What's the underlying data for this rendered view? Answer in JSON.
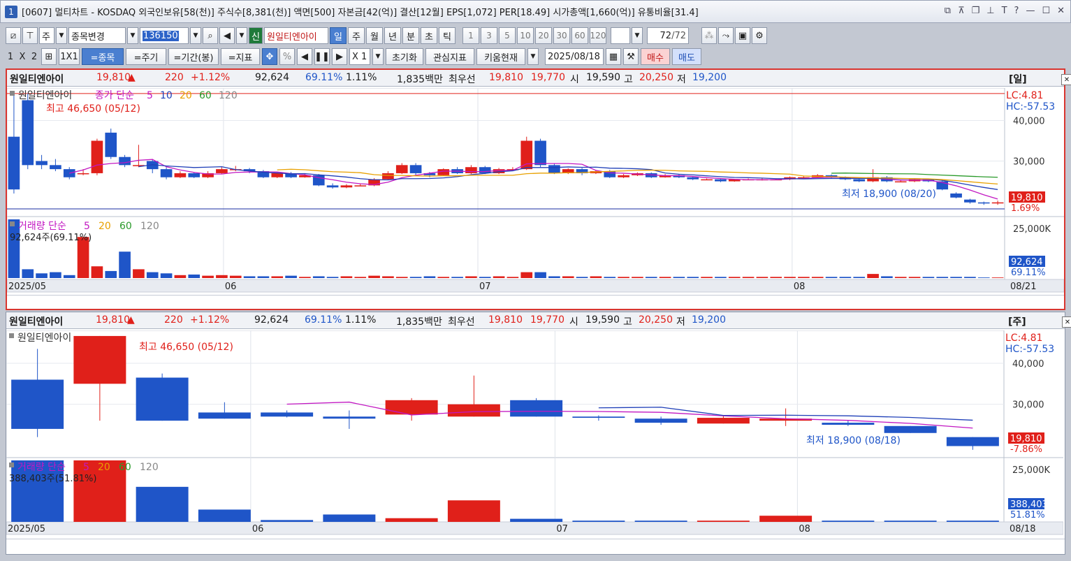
{
  "window": {
    "index": "1",
    "title": "[0607] 멀티차트 - KOSDAQ 외국인보유[58(천)] 주식수[8,381(천)] 액면[500] 자본금[42(억)] 결산[12월] EPS[1,072] PER[18.49] 시가총액[1,660(억)] 유통비율[31.4]"
  },
  "toolbar": {
    "market": "주",
    "change_label": "종목변경",
    "code": "136150",
    "sin": "신",
    "stock_name": "원일티엔아이",
    "periods": [
      "일",
      "주",
      "월",
      "년",
      "분",
      "초",
      "틱"
    ],
    "nums": [
      "1",
      "3",
      "5",
      "10",
      "20",
      "30",
      "60",
      "120"
    ],
    "count": "72",
    "count_total": "/72",
    "layout": [
      "1",
      "X",
      "2"
    ],
    "one_by_one": "1X1",
    "tabs": [
      "=종목",
      "=주기",
      "=기간(봉)",
      "=지표"
    ],
    "pct": "%",
    "mult": "X 1",
    "reset": "초기화",
    "interest": "관심지표",
    "kiwoom": "키움현재",
    "date": "2025/08/18",
    "buy": "매수",
    "sell": "매도"
  },
  "panel1": {
    "name": "원일티엔아이",
    "price": "19,810",
    "arrow": "▲",
    "change": "220",
    "pct": "+1.12%",
    "volume": "92,624",
    "vratio": "69.11%",
    "turn": "1.11%",
    "amount": "1,835백만",
    "best_label": "최우선",
    "ask": "19,810",
    "bid": "19,770",
    "open_l": "시",
    "open": "19,590",
    "high_l": "고",
    "high": "20,250",
    "low_l": "저",
    "low": "19,200",
    "period": "[일]",
    "legend_name": "원일티엔아이",
    "legend_ma": "종가 단순",
    "ma": [
      "5",
      "10",
      "20",
      "60",
      "120"
    ],
    "max_label": "최고 46,650 (05/12)",
    "min_label": "최저 18,900 (08/20)",
    "lc": "LC:4.81",
    "hc": "HC:-57.53",
    "cur_price": "19,810",
    "cur_pct": "1.69%",
    "vol_legend": "거래량 단순",
    "vol_ma": [
      "5",
      "20",
      "60",
      "120"
    ],
    "vol_val": "92,624주(69.11%)",
    "vol_axis": "25,000K",
    "vol_cur": "92,624",
    "vol_pct": "69.11%",
    "dates": [
      "2025/05",
      "06",
      "07",
      "08"
    ],
    "last_date": "08/21"
  },
  "panel2": {
    "name": "원일티엔아이",
    "price": "19,810",
    "arrow": "▲",
    "change": "220",
    "pct": "+1.12%",
    "volume": "92,624",
    "vratio": "69.11%",
    "turn": "1.11%",
    "amount": "1,835백만",
    "best_label": "최우선",
    "ask": "19,810",
    "bid": "19,770",
    "open_l": "시",
    "open": "19,590",
    "high_l": "고",
    "high": "20,250",
    "low_l": "저",
    "low": "19,200",
    "period": "[주]",
    "legend_name": "원일티엔아이",
    "max_label": "최고 46,650 (05/12)",
    "min_label": "최저 18,900 (08/18)",
    "lc": "LC:4.81",
    "hc": "HC:-57.53",
    "cur_price": "19,810",
    "cur_pct": "-7.86%",
    "vol_legend": "거래량 단순",
    "vol_ma": [
      "5",
      "20",
      "60",
      "120"
    ],
    "vol_val": "388,403주(51.81%)",
    "vol_axis": "25,000K",
    "vol_cur": "388,403",
    "vol_pct": "51.81%",
    "dates": [
      "2025/05",
      "06",
      "07",
      "08"
    ],
    "last_date": "08/18"
  },
  "axis": {
    "ticks": [
      "40,000",
      "30,000"
    ]
  },
  "chart_data": [
    {
      "type": "candlestick",
      "title": "원일티엔아이 일봉",
      "ylim": [
        17000,
        48000
      ],
      "candles": [
        [
          36000,
          23000,
          46650,
          22000
        ],
        [
          45000,
          29000,
          46650,
          28000
        ],
        [
          30000,
          29000,
          31500,
          28000
        ],
        [
          29000,
          28000,
          30500,
          27500
        ],
        [
          28000,
          26000,
          28500,
          25500
        ],
        [
          27000,
          27000,
          28000,
          26500
        ],
        [
          27000,
          35000,
          35500,
          26500
        ],
        [
          37000,
          31000,
          38000,
          30500
        ],
        [
          31000,
          29000,
          31500,
          28500
        ],
        [
          29000,
          29000,
          34000,
          28500
        ],
        [
          30000,
          28000,
          30500,
          27000
        ],
        [
          28000,
          26000,
          28500,
          25500
        ],
        [
          26000,
          27000,
          27500,
          25800
        ],
        [
          27000,
          26000,
          27200,
          25800
        ],
        [
          26000,
          27000,
          27500,
          25800
        ],
        [
          27000,
          28000,
          28500,
          26800
        ],
        [
          28000,
          28000,
          28800,
          27500
        ],
        [
          28000,
          27500,
          28300,
          27000
        ],
        [
          27500,
          26000,
          27800,
          25800
        ],
        [
          26000,
          27000,
          27200,
          25800
        ],
        [
          27000,
          26000,
          27300,
          25800
        ],
        [
          26000,
          26500,
          26800,
          25900
        ],
        [
          26500,
          24000,
          26800,
          23800
        ],
        [
          24000,
          23500,
          24500,
          23200
        ],
        [
          23500,
          24000,
          24300,
          23300
        ],
        [
          24000,
          24000,
          24500,
          23800
        ],
        [
          24000,
          25500,
          25800,
          23800
        ],
        [
          25500,
          27000,
          27500,
          25300
        ],
        [
          27000,
          29000,
          29500,
          26800
        ],
        [
          29000,
          27000,
          29500,
          26500
        ],
        [
          27000,
          26500,
          27300,
          26000
        ],
        [
          26500,
          28000,
          28200,
          26300
        ],
        [
          28000,
          27000,
          28500,
          26800
        ],
        [
          27000,
          28500,
          29000,
          26800
        ],
        [
          28500,
          27000,
          28800,
          26800
        ],
        [
          27000,
          28000,
          28300,
          26800
        ],
        [
          28000,
          28000,
          28500,
          27500
        ],
        [
          28000,
          35000,
          36000,
          27800
        ],
        [
          35000,
          29000,
          35500,
          28500
        ],
        [
          29000,
          27000,
          29300,
          26800
        ],
        [
          27000,
          28000,
          28200,
          26800
        ],
        [
          28000,
          27000,
          28300,
          26500
        ],
        [
          27000,
          27500,
          27800,
          26800
        ],
        [
          27500,
          26000,
          27800,
          25800
        ],
        [
          26000,
          26500,
          26800,
          25800
        ],
        [
          26500,
          27000,
          27200,
          26300
        ],
        [
          27000,
          26000,
          27200,
          25800
        ],
        [
          26000,
          26500,
          26800,
          25900
        ],
        [
          26500,
          26000,
          26700,
          25800
        ],
        [
          26000,
          25500,
          26200,
          25300
        ],
        [
          25500,
          25500,
          25700,
          25300
        ],
        [
          25500,
          25000,
          25700,
          24800
        ],
        [
          25000,
          25500,
          25600,
          24900
        ],
        [
          25500,
          25500,
          25700,
          25300
        ],
        [
          25500,
          25500,
          25700,
          25200
        ],
        [
          25500,
          25500,
          25700,
          25300
        ],
        [
          25500,
          26000,
          26200,
          25300
        ],
        [
          26000,
          26000,
          26200,
          25800
        ],
        [
          26000,
          26500,
          26800,
          25800
        ],
        [
          26500,
          26000,
          26700,
          25800
        ],
        [
          26000,
          25500,
          26200,
          25300
        ],
        [
          25500,
          25000,
          25700,
          24800
        ],
        [
          25000,
          26000,
          28000,
          24800
        ],
        [
          26000,
          25000,
          26300,
          24800
        ],
        [
          25000,
          25000,
          25300,
          24800
        ],
        [
          25000,
          25500,
          25700,
          24800
        ],
        [
          25500,
          25000,
          25700,
          24800
        ],
        [
          25000,
          23000,
          25200,
          22800
        ],
        [
          22000,
          21000,
          22300,
          20800
        ],
        [
          20500,
          19800,
          20700,
          19500
        ],
        [
          19800,
          19600,
          20000,
          19200
        ],
        [
          19590,
          19810,
          20250,
          19200
        ]
      ],
      "volume": [
        100,
        15,
        8,
        10,
        5,
        70,
        20,
        12,
        45,
        15,
        10,
        8,
        5,
        6,
        4,
        5,
        4,
        3,
        3,
        3,
        4,
        2,
        3,
        2,
        3,
        2,
        4,
        3,
        2,
        2,
        3,
        2,
        2,
        3,
        2,
        3,
        2,
        10,
        10,
        3,
        3,
        2,
        3,
        2,
        2,
        2,
        2,
        2,
        2,
        2,
        2,
        2,
        2,
        2,
        2,
        2,
        2,
        2,
        2,
        2,
        2,
        2,
        7,
        3,
        2,
        2,
        2,
        2,
        2,
        2,
        1,
        1
      ]
    },
    {
      "type": "candlestick",
      "title": "원일티엔아이 주봉",
      "ylim": [
        17000,
        48000
      ],
      "candles": [
        [
          36000,
          24000,
          43500,
          22000
        ],
        [
          35000,
          46650,
          46650,
          26000
        ],
        [
          36500,
          26000,
          37500,
          26000
        ],
        [
          28000,
          26500,
          30500,
          26500
        ],
        [
          28000,
          27000,
          28500,
          26800
        ],
        [
          27000,
          26500,
          28500,
          24000
        ],
        [
          27500,
          31000,
          31500,
          26000
        ],
        [
          27000,
          30000,
          37000,
          27000
        ],
        [
          31000,
          27000,
          31500,
          27000
        ],
        [
          27000,
          26700,
          27300,
          26000
        ],
        [
          26500,
          25500,
          27000,
          25000
        ],
        [
          25300,
          26700,
          27200,
          25300
        ],
        [
          26000,
          26500,
          29000,
          24700
        ],
        [
          25500,
          25000,
          26000,
          24700
        ],
        [
          24700,
          23000,
          24700,
          23000
        ],
        [
          22000,
          19810,
          22000,
          18900
        ]
      ],
      "volume": [
        100,
        100,
        57,
        20,
        3,
        12,
        6,
        35,
        5,
        2,
        2,
        2,
        10,
        2,
        2,
        2
      ]
    }
  ]
}
